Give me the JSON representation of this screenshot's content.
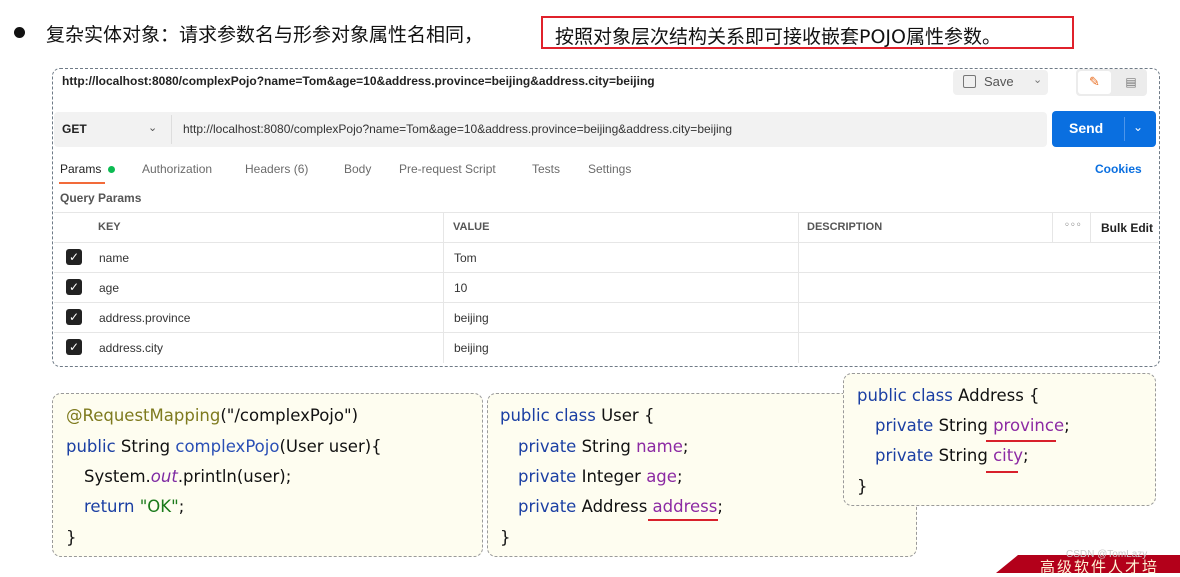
{
  "heading": {
    "text": "复杂实体对象：请求参数名与形参对象属性名相同，",
    "highlighted": "按照对象层次结构关系即可接收嵌套POJO属性参数。"
  },
  "postman": {
    "request_title": "http://localhost:8080/complexPojo?name=Tom&age=10&address.province=beijing&address.city=beijing",
    "save_label": "Save",
    "method": "GET",
    "url": "http://localhost:8080/complexPojo?name=Tom&age=10&address.province=beijing&address.city=beijing",
    "send_label": "Send",
    "tabs": [
      "Params",
      "Authorization",
      "Headers (6)",
      "Body",
      "Pre-request Script",
      "Tests",
      "Settings"
    ],
    "cookies_label": "Cookies",
    "query_params_label": "Query Params",
    "columns": [
      "KEY",
      "VALUE",
      "DESCRIPTION"
    ],
    "bulk_edit_label": "Bulk Edit",
    "rows": [
      {
        "key": "name",
        "value": "Tom"
      },
      {
        "key": "age",
        "value": "10"
      },
      {
        "key": "address.province",
        "value": "beijing"
      },
      {
        "key": "address.city",
        "value": "beijing"
      }
    ]
  },
  "code": {
    "controller": {
      "l1_ann": "@RequestMapping",
      "l1_rest": "(\"/complexPojo\")",
      "l2_kw": "public",
      "l2_type": " String ",
      "l2_fn": "complexPojo",
      "l2_rest": "(User user){",
      "l3_a": "System.",
      "l3_out": "out",
      "l3_b": ".println(user);",
      "l4_kw": "return",
      "l4_str": "\"OK\"",
      "l4_end": ";",
      "l5": "}"
    },
    "user_class": {
      "l1_kw": "public class",
      "l1_rest": " User {",
      "l2_kw": "private",
      "l2_type": " String ",
      "l2_field": "name",
      "l2_end": ";",
      "l3_kw": "private",
      "l3_type": " Integer ",
      "l3_field": "age",
      "l3_end": ";",
      "l4_kw": "private",
      "l4_type": " Address ",
      "l4_field": "address",
      "l4_end": ";",
      "l5": "}"
    },
    "address_class": {
      "l1_kw": "public class",
      "l1_rest": " Address {",
      "l2_kw": "private",
      "l2_type": " String ",
      "l2_field": "province",
      "l2_end": ";",
      "l3_kw": "private",
      "l3_type": " String ",
      "l3_field": "city",
      "l3_end": ";",
      "l4": "}"
    }
  },
  "watermark": "CSDN @TomLazy",
  "banner": "高级软件人才培"
}
